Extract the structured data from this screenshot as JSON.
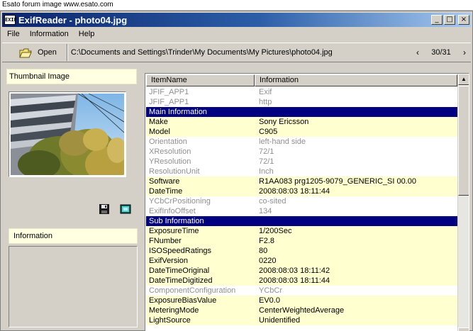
{
  "banner": {
    "text": "Esato forum image www.esato.com"
  },
  "window": {
    "icon_text": "EXIF",
    "title": "ExifReader - photo04.jpg",
    "minimize": "_",
    "maximize": "□",
    "close": "×"
  },
  "menu": {
    "items": [
      "File",
      "Information",
      "Help"
    ]
  },
  "toolbar": {
    "open_label": "Open",
    "path": "C:\\Documents and Settings\\Trinder\\My Documents\\My Pictures\\photo04.jpg",
    "prev": "‹",
    "next": "›",
    "page_count": "30/31"
  },
  "left": {
    "thumbnail_header": "Thumbnail Image",
    "info_header": "Information"
  },
  "table": {
    "columns": [
      "ItemName",
      "Information"
    ],
    "rows": [
      {
        "k": "JFIF_APP1",
        "v": "Exif",
        "style": "gray"
      },
      {
        "k": "JFIF_APP1",
        "v": "http",
        "style": "gray"
      },
      {
        "k": "Main Information",
        "v": "",
        "style": "section"
      },
      {
        "k": "Make",
        "v": "Sony Ericsson",
        "style": "yellow"
      },
      {
        "k": "Model",
        "v": "C905",
        "style": "yellow"
      },
      {
        "k": "Orientation",
        "v": "left-hand side",
        "style": "gray"
      },
      {
        "k": "XResolution",
        "v": "72/1",
        "style": "gray"
      },
      {
        "k": "YResolution",
        "v": "72/1",
        "style": "gray"
      },
      {
        "k": "ResolutionUnit",
        "v": "Inch",
        "style": "gray"
      },
      {
        "k": "Software",
        "v": "R1AA083     prg1205-9079_GENERIC_SI 00.00",
        "style": "yellow"
      },
      {
        "k": "DateTime",
        "v": "2008:08:03 18:11:44",
        "style": "yellow"
      },
      {
        "k": "YCbCrPositioning",
        "v": "co-sited",
        "style": "gray"
      },
      {
        "k": "ExifInfoOffset",
        "v": "134",
        "style": "gray"
      },
      {
        "k": "Sub Information",
        "v": "",
        "style": "section"
      },
      {
        "k": "ExposureTime",
        "v": "1/200Sec",
        "style": "yellow"
      },
      {
        "k": "FNumber",
        "v": "F2.8",
        "style": "yellow"
      },
      {
        "k": "ISOSpeedRatings",
        "v": "80",
        "style": "yellow"
      },
      {
        "k": "ExifVersion",
        "v": "0220",
        "style": "yellow"
      },
      {
        "k": "DateTimeOriginal",
        "v": "2008:08:03 18:11:42",
        "style": "yellow"
      },
      {
        "k": "DateTimeDigitized",
        "v": "2008:08:03 18:11:44",
        "style": "yellow"
      },
      {
        "k": "ComponentConfiguration",
        "v": "YCbCr",
        "style": "gray"
      },
      {
        "k": "ExposureBiasValue",
        "v": "EV0.0",
        "style": "yellow"
      },
      {
        "k": "MeteringMode",
        "v": "CenterWeightedAverage",
        "style": "yellow"
      },
      {
        "k": "LightSource",
        "v": "Unidentified",
        "style": "yellow"
      }
    ]
  },
  "scrollbar": {
    "up": "▲",
    "down": "▼"
  },
  "icons": {
    "open": "open-folder-icon",
    "save": "save-disk-icon",
    "view": "view-image-icon"
  }
}
